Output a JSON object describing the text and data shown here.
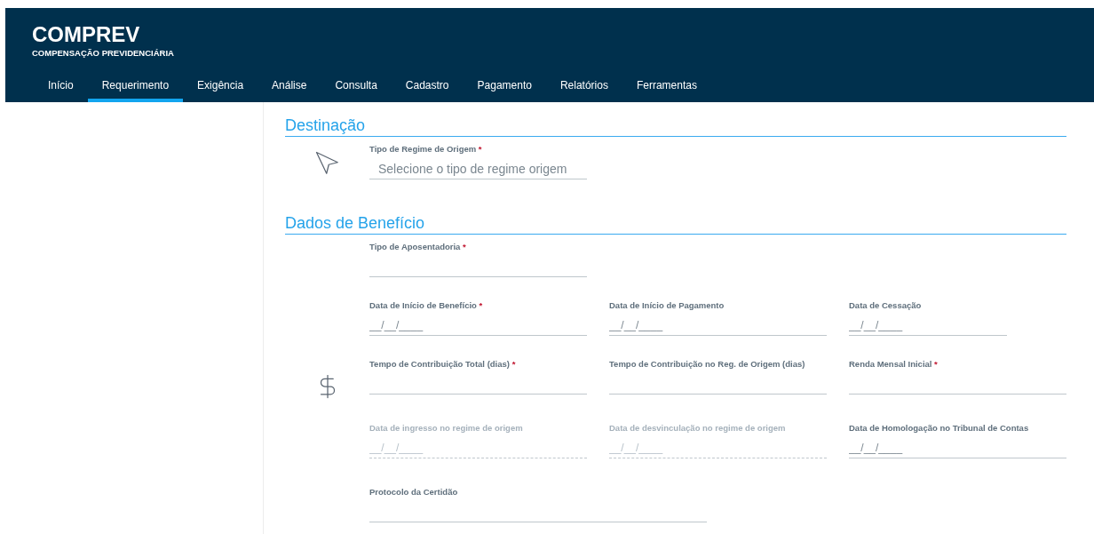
{
  "header": {
    "title": "COMPREV",
    "subtitle": "COMPENSAÇÃO PREVIDENCIÁRIA"
  },
  "nav": [
    {
      "label": "Início",
      "selected": false
    },
    {
      "label": "Requerimento",
      "selected": true
    },
    {
      "label": "Exigência",
      "selected": false
    },
    {
      "label": "Análise",
      "selected": false
    },
    {
      "label": "Consulta",
      "selected": false
    },
    {
      "label": "Cadastro",
      "selected": false
    },
    {
      "label": "Pagamento",
      "selected": false
    },
    {
      "label": "Relatórios",
      "selected": false
    },
    {
      "label": "Ferramentas",
      "selected": false
    }
  ],
  "sections": [
    {
      "title": "Destinação",
      "rows": [
        [
          {
            "label": "Tipo de Regime de Origem",
            "required": "*",
            "placeholder": "Selecione o tipo de regime origem",
            "kind": "select",
            "disabled": false
          }
        ]
      ]
    },
    {
      "title": "Dados de Benefício",
      "rows": [
        [
          {
            "label": "Tipo de Aposentadoria",
            "required": "*",
            "kind": "select",
            "disabled": false
          }
        ],
        [
          {
            "label": "Data de Início de Benefício",
            "required": "*",
            "placeholder": "__/__/____",
            "kind": "date",
            "disabled": false
          },
          {
            "label": "Data de Início de Pagamento",
            "placeholder": "__/__/____",
            "kind": "date",
            "disabled": false
          },
          {
            "label": "Data de Cessação",
            "placeholder": "__/__/____",
            "kind": "short",
            "disabled": false
          }
        ],
        [
          {
            "label": "Tempo de Contribuição Total (dias)",
            "required": "*",
            "kind": "text",
            "disabled": false
          },
          {
            "label": "Tempo de Contribuição no Reg. de Origem (dias)",
            "kind": "text",
            "disabled": false
          },
          {
            "label": "Renda Mensal Inicial",
            "required": "*",
            "kind": "text",
            "disabled": false
          }
        ],
        [
          {
            "label": "Data de ingresso no regime de origem",
            "placeholder": "__/__/____",
            "kind": "date",
            "disabled": true
          },
          {
            "label": "Data de desvinculação no regime de origem",
            "placeholder": "__/__/____",
            "kind": "date",
            "disabled": true
          },
          {
            "label": "Data de Homologação no Tribunal de Contas",
            "placeholder": "__/__/____",
            "kind": "date",
            "disabled": false
          }
        ],
        [
          {
            "label": "Protocolo da Certidão",
            "kind": "wide",
            "disabled": false
          }
        ]
      ]
    }
  ]
}
